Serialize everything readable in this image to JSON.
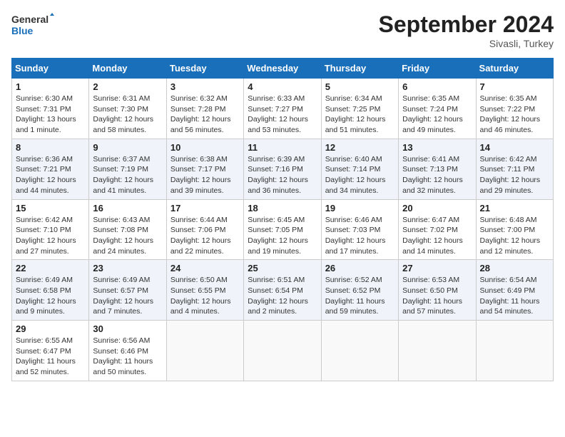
{
  "header": {
    "logo_line1": "General",
    "logo_line2": "Blue",
    "month": "September 2024",
    "location": "Sivasli, Turkey"
  },
  "weekdays": [
    "Sunday",
    "Monday",
    "Tuesday",
    "Wednesday",
    "Thursday",
    "Friday",
    "Saturday"
  ],
  "weeks": [
    [
      {
        "day": "1",
        "sunrise": "6:30 AM",
        "sunset": "7:31 PM",
        "daylight": "13 hours and 1 minute."
      },
      {
        "day": "2",
        "sunrise": "6:31 AM",
        "sunset": "7:30 PM",
        "daylight": "12 hours and 58 minutes."
      },
      {
        "day": "3",
        "sunrise": "6:32 AM",
        "sunset": "7:28 PM",
        "daylight": "12 hours and 56 minutes."
      },
      {
        "day": "4",
        "sunrise": "6:33 AM",
        "sunset": "7:27 PM",
        "daylight": "12 hours and 53 minutes."
      },
      {
        "day": "5",
        "sunrise": "6:34 AM",
        "sunset": "7:25 PM",
        "daylight": "12 hours and 51 minutes."
      },
      {
        "day": "6",
        "sunrise": "6:35 AM",
        "sunset": "7:24 PM",
        "daylight": "12 hours and 49 minutes."
      },
      {
        "day": "7",
        "sunrise": "6:35 AM",
        "sunset": "7:22 PM",
        "daylight": "12 hours and 46 minutes."
      }
    ],
    [
      {
        "day": "8",
        "sunrise": "6:36 AM",
        "sunset": "7:21 PM",
        "daylight": "12 hours and 44 minutes."
      },
      {
        "day": "9",
        "sunrise": "6:37 AM",
        "sunset": "7:19 PM",
        "daylight": "12 hours and 41 minutes."
      },
      {
        "day": "10",
        "sunrise": "6:38 AM",
        "sunset": "7:17 PM",
        "daylight": "12 hours and 39 minutes."
      },
      {
        "day": "11",
        "sunrise": "6:39 AM",
        "sunset": "7:16 PM",
        "daylight": "12 hours and 36 minutes."
      },
      {
        "day": "12",
        "sunrise": "6:40 AM",
        "sunset": "7:14 PM",
        "daylight": "12 hours and 34 minutes."
      },
      {
        "day": "13",
        "sunrise": "6:41 AM",
        "sunset": "7:13 PM",
        "daylight": "12 hours and 32 minutes."
      },
      {
        "day": "14",
        "sunrise": "6:42 AM",
        "sunset": "7:11 PM",
        "daylight": "12 hours and 29 minutes."
      }
    ],
    [
      {
        "day": "15",
        "sunrise": "6:42 AM",
        "sunset": "7:10 PM",
        "daylight": "12 hours and 27 minutes."
      },
      {
        "day": "16",
        "sunrise": "6:43 AM",
        "sunset": "7:08 PM",
        "daylight": "12 hours and 24 minutes."
      },
      {
        "day": "17",
        "sunrise": "6:44 AM",
        "sunset": "7:06 PM",
        "daylight": "12 hours and 22 minutes."
      },
      {
        "day": "18",
        "sunrise": "6:45 AM",
        "sunset": "7:05 PM",
        "daylight": "12 hours and 19 minutes."
      },
      {
        "day": "19",
        "sunrise": "6:46 AM",
        "sunset": "7:03 PM",
        "daylight": "12 hours and 17 minutes."
      },
      {
        "day": "20",
        "sunrise": "6:47 AM",
        "sunset": "7:02 PM",
        "daylight": "12 hours and 14 minutes."
      },
      {
        "day": "21",
        "sunrise": "6:48 AM",
        "sunset": "7:00 PM",
        "daylight": "12 hours and 12 minutes."
      }
    ],
    [
      {
        "day": "22",
        "sunrise": "6:49 AM",
        "sunset": "6:58 PM",
        "daylight": "12 hours and 9 minutes."
      },
      {
        "day": "23",
        "sunrise": "6:49 AM",
        "sunset": "6:57 PM",
        "daylight": "12 hours and 7 minutes."
      },
      {
        "day": "24",
        "sunrise": "6:50 AM",
        "sunset": "6:55 PM",
        "daylight": "12 hours and 4 minutes."
      },
      {
        "day": "25",
        "sunrise": "6:51 AM",
        "sunset": "6:54 PM",
        "daylight": "12 hours and 2 minutes."
      },
      {
        "day": "26",
        "sunrise": "6:52 AM",
        "sunset": "6:52 PM",
        "daylight": "11 hours and 59 minutes."
      },
      {
        "day": "27",
        "sunrise": "6:53 AM",
        "sunset": "6:50 PM",
        "daylight": "11 hours and 57 minutes."
      },
      {
        "day": "28",
        "sunrise": "6:54 AM",
        "sunset": "6:49 PM",
        "daylight": "11 hours and 54 minutes."
      }
    ],
    [
      {
        "day": "29",
        "sunrise": "6:55 AM",
        "sunset": "6:47 PM",
        "daylight": "11 hours and 52 minutes."
      },
      {
        "day": "30",
        "sunrise": "6:56 AM",
        "sunset": "6:46 PM",
        "daylight": "11 hours and 50 minutes."
      },
      null,
      null,
      null,
      null,
      null
    ]
  ]
}
